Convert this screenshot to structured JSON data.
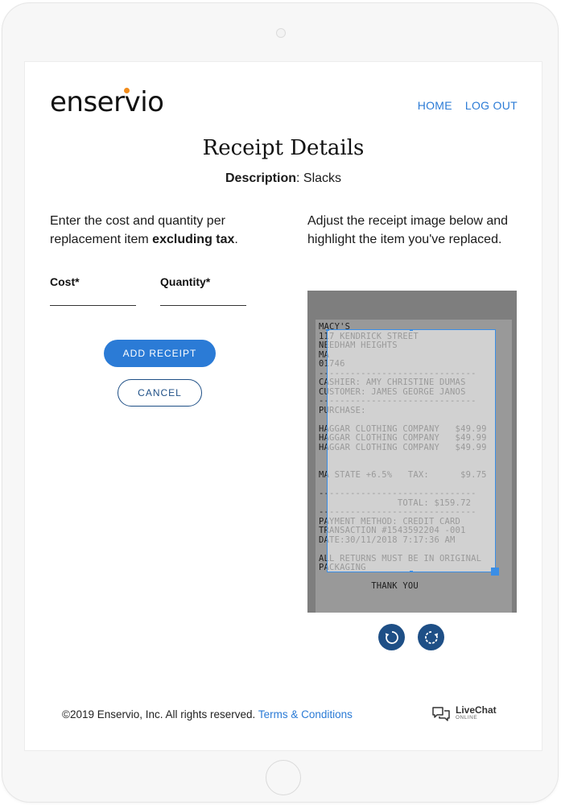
{
  "brand": {
    "logo_text": "enservio",
    "accent_color": "#f28c1b"
  },
  "nav": {
    "home": "HOME",
    "logout": "LOG OUT"
  },
  "page": {
    "title": "Receipt Details",
    "description_label": "Description",
    "description_value": ": Slacks"
  },
  "instructions": {
    "left_part1": "Enter the cost and quantity per replacement item ",
    "left_bold": "excluding tax",
    "left_part2": ".",
    "right": "Adjust the receipt image below and highlight the item you've replaced."
  },
  "form": {
    "cost_label": "Cost*",
    "cost_value": "",
    "quantity_label": "Quantity*",
    "quantity_value": ""
  },
  "buttons": {
    "add_receipt": "ADD RECEIPT",
    "cancel": "CANCEL",
    "rotate_left_icon": "rotate-left-icon",
    "rotate_right_icon": "rotate-right-icon"
  },
  "receipt": {
    "lines": [
      "MACY'S",
      "117 KENDRICK STREET",
      "NEEDHAM HEIGHTS",
      "MA",
      "01746",
      "------------------------------",
      "CASHIER: AMY CHRISTINE DUMAS",
      "CUSTOMER: JAMES GEORGE JANOS",
      "------------------------------",
      "PURCHASE:",
      "",
      "HAGGAR CLOTHING COMPANY   $49.99",
      "HAGGAR CLOTHING COMPANY   $49.99",
      "HAGGAR CLOTHING COMPANY   $49.99",
      "",
      "",
      "MA STATE +6.5%   TAX:      $9.75",
      "",
      "------------------------------",
      "               TOTAL: $159.72",
      "------------------------------",
      "PAYMENT METHOD: CREDIT CARD",
      "TRANSACTION #1543592204 -001",
      "DATE:30/11/2018 7:17:36 AM",
      "",
      "ALL RETURNS MUST BE IN ORIGINAL",
      "PACKAGING",
      "",
      "          THANK YOU"
    ]
  },
  "footer": {
    "copyright": "©2019 Enservio, Inc. All rights reserved. ",
    "terms": "Terms & Conditions",
    "livechat_main": "LiveChat",
    "livechat_sub": "ONLINE",
    "livechat_icon": "chat-bubbles-icon"
  },
  "colors": {
    "link_blue": "#2b7bd6",
    "dark_blue": "#1e4f86",
    "highlight_blue": "#3a8ee6"
  }
}
